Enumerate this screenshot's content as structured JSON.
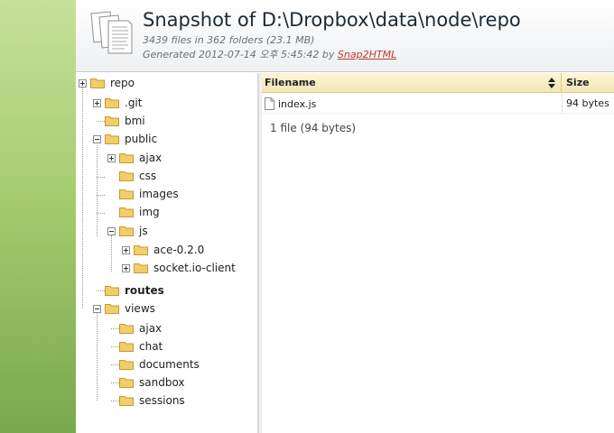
{
  "header": {
    "title": "Snapshot of D:\\Dropbox\\data\\node\\repo",
    "stats": "3439 files in 362 folders (23.1 MB)",
    "generated_prefix": "Generated 2012-07-14 오후 5:45:42 by",
    "generator_link": "Snap2HTML"
  },
  "tree": {
    "nodes": [
      {
        "id": "repo",
        "label": "repo",
        "toggle": "plus"
      },
      {
        "id": "git",
        "label": ".git",
        "toggle": "plus"
      },
      {
        "id": "bmi",
        "label": "bmi",
        "toggle": "none"
      },
      {
        "id": "public",
        "label": "public",
        "toggle": "minus"
      },
      {
        "id": "ajax",
        "label": "ajax",
        "toggle": "plus"
      },
      {
        "id": "css",
        "label": "css",
        "toggle": "none"
      },
      {
        "id": "images",
        "label": "images",
        "toggle": "none"
      },
      {
        "id": "img",
        "label": "img",
        "toggle": "none"
      },
      {
        "id": "js",
        "label": "js",
        "toggle": "minus"
      },
      {
        "id": "ace",
        "label": "ace-0.2.0",
        "toggle": "plus"
      },
      {
        "id": "socketio",
        "label": "socket.io-client",
        "toggle": "plus"
      },
      {
        "id": "routes",
        "label": "routes",
        "toggle": "none",
        "selected": true
      },
      {
        "id": "views",
        "label": "views",
        "toggle": "minus"
      },
      {
        "id": "vajax",
        "label": "ajax",
        "toggle": "none"
      },
      {
        "id": "chat",
        "label": "chat",
        "toggle": "none"
      },
      {
        "id": "documents",
        "label": "documents",
        "toggle": "none"
      },
      {
        "id": "sandbox",
        "label": "sandbox",
        "toggle": "none"
      },
      {
        "id": "sessions",
        "label": "sessions",
        "toggle": "none"
      }
    ]
  },
  "file_list": {
    "columns": {
      "name": "Filename",
      "size": "Size"
    },
    "rows": [
      {
        "name": "index.js",
        "size": "94 bytes"
      }
    ],
    "summary": "1 file (94 bytes)"
  },
  "colors": {
    "folder": "#f2cd6b",
    "link": "#c0392b",
    "strip": "#9cc463"
  },
  "icons": [
    "documents-icon",
    "folder-icon",
    "file-icon",
    "sort-icon",
    "expand-icon",
    "collapse-icon"
  ]
}
